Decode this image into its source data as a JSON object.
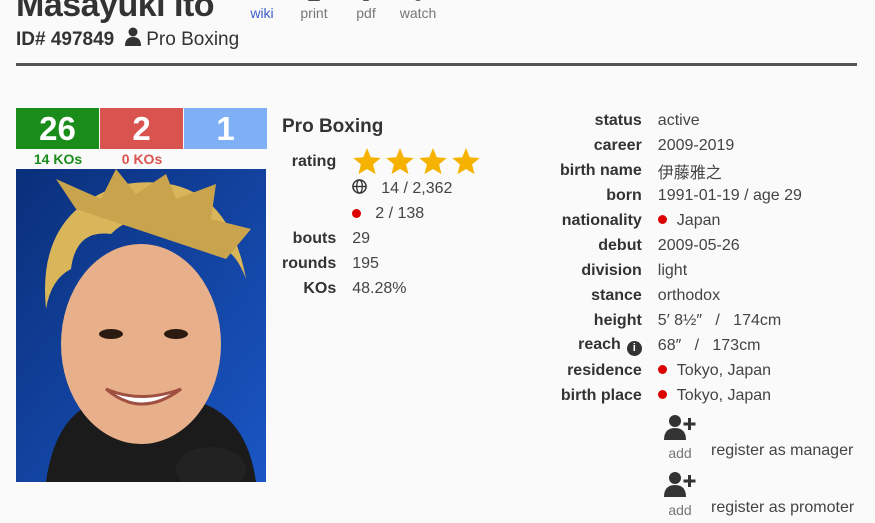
{
  "header": {
    "name": "Masayuki Ito",
    "id_text": "ID# 497849",
    "sport": "Pro Boxing",
    "tools": [
      {
        "label": "wiki",
        "icon": "wiki-icon"
      },
      {
        "label": "print",
        "icon": "print-icon"
      },
      {
        "label": "pdf",
        "icon": "pdf-icon"
      },
      {
        "label": "watch",
        "icon": "watch-icon"
      }
    ]
  },
  "record": {
    "wins": "26",
    "losses": "2",
    "draws": "1",
    "win_kos": "14 KOs",
    "loss_kos": "0 KOs",
    "colors": {
      "win": "#1a8c1a",
      "loss": "#d9534f",
      "draw": "#7fb0f5"
    }
  },
  "summary": {
    "title": "Pro Boxing",
    "rating_label": "rating",
    "rating_stars": 4,
    "world_rank": "14 / 2,362",
    "country_rank": "2 / 138",
    "bouts_label": "bouts",
    "bouts": "29",
    "rounds_label": "rounds",
    "rounds": "195",
    "kos_label": "KOs",
    "kos": "48.28%"
  },
  "details": {
    "status_label": "status",
    "status": "active",
    "career_label": "career",
    "career": "2009-2019",
    "birth_name_label": "birth name",
    "birth_name": "伊藤雅之",
    "born_label": "born",
    "born": "1991-01-19 / age 29",
    "nationality_label": "nationality",
    "nationality": "Japan",
    "debut_label": "debut",
    "debut": "2009-05-26",
    "division_label": "division",
    "division": "light",
    "stance_label": "stance",
    "stance": "orthodox",
    "height_label": "height",
    "height": "5′ 8½″   /   174cm",
    "reach_label": "reach",
    "reach": "68″   /   173cm",
    "residence_label": "residence",
    "residence": "Tokyo, Japan",
    "birth_place_label": "birth place",
    "birth_place": "Tokyo, Japan"
  },
  "registration": {
    "add_label": "add",
    "manager": "register as manager",
    "promoter": "register as promoter"
  }
}
